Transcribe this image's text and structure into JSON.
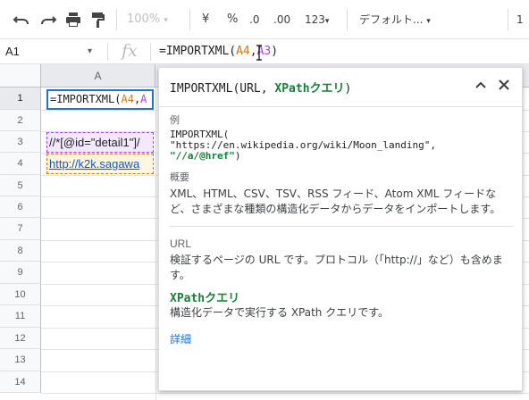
{
  "toolbar": {
    "zoom": "100%",
    "currency": "¥",
    "percent": "%",
    "decimal_decrease": ".0",
    "decimal_increase": ".00",
    "number_format": "123",
    "font_family": "デフォルト...",
    "font_size": "1",
    "icons": [
      "undo-icon",
      "redo-icon",
      "print-icon",
      "paint-format-icon"
    ]
  },
  "formula_bar": {
    "name_box": "A1",
    "fx": "fx",
    "formula_prefix": "=IMPORTXML(",
    "formula_ref1": "A4",
    "formula_comma": ",",
    "formula_ref2": "A3",
    "formula_suffix": ")"
  },
  "grid": {
    "columns": [
      "A"
    ],
    "rows": [
      "1",
      "2",
      "3",
      "4",
      "5",
      "6",
      "7",
      "8",
      "9",
      "10",
      "11",
      "12",
      "13",
      "14"
    ],
    "cells": {
      "a1_prefix": "=IMPORTXML(",
      "a1_ref": "A4",
      "a1_comma": ",",
      "a1_tail": "A",
      "a3": "//*[@id=\"detail1\"]/",
      "a4": "http://k2k.sagawa"
    }
  },
  "help": {
    "title_fn": "IMPORTXML(URL, ",
    "title_param": "XPathクエリ",
    "title_close_paren": ")",
    "example_label": "例",
    "example_line1": "IMPORTXML(",
    "example_line2": "\"https://en.wikipedia.org/wiki/Moon_landing\",",
    "example_line3_hl": "\"//a/@href\"",
    "example_line3_end": ")",
    "summary_label": "概要",
    "summary_text": "XML、HTML、CSV、TSV、RSS フィード、Atom XML フィードなど、さまざまな種類の構造化データからデータをインポートします。",
    "url_label": "URL",
    "url_text": "検証するページの URL です。プロトコル（「http://」など）も含めます。",
    "xpath_label": "XPathクエリ",
    "xpath_text": "構造化データで実行する XPath クエリです。",
    "details_link": "詳細"
  },
  "colors": {
    "accent_blue": "#1a73e8",
    "param_green": "#188038",
    "ref_orange": "#e37400",
    "ref_purple": "#a142f4"
  }
}
